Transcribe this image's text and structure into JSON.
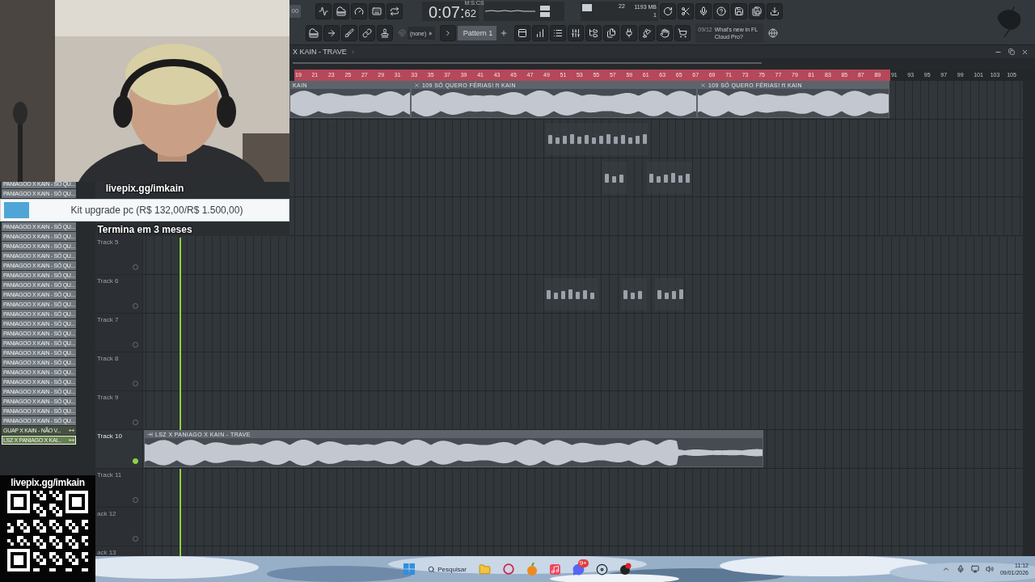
{
  "toolbar": {
    "tempo": "00",
    "time_unit": "M:S:CS",
    "time": "0:07:",
    "time_cs": "62",
    "cpu": "22",
    "memory": "1193 MB",
    "polyphony": "1",
    "snap": "(none)",
    "pattern": "Pattern 1",
    "news_count": "09/12",
    "news": "What's new in FL Cloud Pro?"
  },
  "pattern_list": [
    {
      "label": "PANIAGOO X KAIN - SÓ QU...",
      "kind": "pattern",
      "selected": false
    },
    {
      "label": "PANIAGOO X KAIN - SÓ QU...",
      "kind": "pattern",
      "selected": false
    },
    {
      "label": "PANIAGOO X KAIN - SÓ QU...",
      "kind": "pattern",
      "selected": false
    },
    {
      "label": "PANIAGOO X KAIN - SÓ QU...",
      "kind": "pattern",
      "selected": false
    },
    {
      "label": "PANIAGOO X KAIN - SÓ QU...",
      "kind": "pattern",
      "selected": false
    },
    {
      "label": "PANIAGOO X KAIN - SÓ QU...",
      "kind": "pattern",
      "selected": false
    },
    {
      "label": "PANIAGOO X KAIN - SÓ QU...",
      "kind": "pattern",
      "selected": false
    },
    {
      "label": "PANIAGOO X KAIN - SÓ QU...",
      "kind": "pattern",
      "selected": false
    },
    {
      "label": "PANIAGOO X KAIN - SÓ QU...",
      "kind": "pattern",
      "selected": false
    },
    {
      "label": "PANIAGOO X KAIN - SÓ QU...",
      "kind": "pattern",
      "selected": false
    },
    {
      "label": "PANIAGOO X KAIN - SÓ QU...",
      "kind": "pattern",
      "selected": false
    },
    {
      "label": "PANIAGOO X KAIN - SÓ QU...",
      "kind": "pattern",
      "selected": false
    },
    {
      "label": "PANIAGOO X KAIN - SÓ QU...",
      "kind": "pattern",
      "selected": false
    },
    {
      "label": "PANIAGOO X KAIN - SÓ QU...",
      "kind": "pattern",
      "selected": false
    },
    {
      "label": "PANIAGOO X KAIN - SÓ QU...",
      "kind": "pattern",
      "selected": false
    },
    {
      "label": "PANIAGOO X KAIN - SÓ QU...",
      "kind": "pattern",
      "selected": false
    },
    {
      "label": "PANIAGOO X KAIN - SÓ QU...",
      "kind": "pattern",
      "selected": false
    },
    {
      "label": "PANIAGOO X KAIN - SÓ QU...",
      "kind": "pattern",
      "selected": false
    },
    {
      "label": "PANIAGOO X KAIN - SÓ QU...",
      "kind": "pattern",
      "selected": false
    },
    {
      "label": "PANIAGOO X KAIN - SÓ QU...",
      "kind": "pattern",
      "selected": false
    },
    {
      "label": "PANIAGOO X KAIN - SÓ QU...",
      "kind": "pattern",
      "selected": false
    },
    {
      "label": "PANIAGOO X KAIN - SÓ QU...",
      "kind": "pattern",
      "selected": false
    },
    {
      "label": "PANIAGOO X KAIN - SÓ QU...",
      "kind": "pattern",
      "selected": false
    },
    {
      "label": "GUAP X KAIN - NÃO V...",
      "kind": "audio",
      "selected": false
    },
    {
      "label": "LSZ X PANIAGO X KAI...",
      "kind": "audio",
      "selected": true
    }
  ],
  "playlist": {
    "title": "X KAIN - TRAVE",
    "ruler": [
      {
        "label": "19",
        "selected": true
      },
      {
        "label": "21",
        "selected": true
      },
      {
        "label": "23",
        "selected": true
      },
      {
        "label": "25",
        "selected": true
      },
      {
        "label": "27",
        "selected": true
      },
      {
        "label": "29",
        "selected": true
      },
      {
        "label": "31",
        "selected": true
      },
      {
        "label": "33",
        "selected": true
      },
      {
        "label": "35",
        "selected": true
      },
      {
        "label": "37",
        "selected": true
      },
      {
        "label": "39",
        "selected": true
      },
      {
        "label": "41",
        "selected": true
      },
      {
        "label": "43",
        "selected": true
      },
      {
        "label": "45",
        "selected": true
      },
      {
        "label": "47",
        "selected": true
      },
      {
        "label": "49",
        "selected": true
      },
      {
        "label": "51",
        "selected": true
      },
      {
        "label": "53",
        "selected": true
      },
      {
        "label": "55",
        "selected": true
      },
      {
        "label": "57",
        "selected": true
      },
      {
        "label": "59",
        "selected": true
      },
      {
        "label": "61",
        "selected": true
      },
      {
        "label": "63",
        "selected": true
      },
      {
        "label": "65",
        "selected": true
      },
      {
        "label": "67",
        "selected": true
      },
      {
        "label": "69",
        "selected": true
      },
      {
        "label": "71",
        "selected": true
      },
      {
        "label": "73",
        "selected": true
      },
      {
        "label": "75",
        "selected": true
      },
      {
        "label": "77",
        "selected": true
      },
      {
        "label": "79",
        "selected": true
      },
      {
        "label": "81",
        "selected": true
      },
      {
        "label": "83",
        "selected": true
      },
      {
        "label": "85",
        "selected": true
      },
      {
        "label": "87",
        "selected": true
      },
      {
        "label": "89",
        "selected": true
      },
      {
        "label": "91",
        "selected": false
      },
      {
        "label": "93",
        "selected": false
      },
      {
        "label": "95",
        "selected": false
      },
      {
        "label": "97",
        "selected": false
      },
      {
        "label": "99",
        "selected": false
      },
      {
        "label": "101",
        "selected": false
      },
      {
        "label": "103",
        "selected": false
      },
      {
        "label": "105",
        "selected": false
      }
    ],
    "track_headers": [
      {
        "name": "Track 5",
        "active": false
      },
      {
        "name": "Track 6",
        "active": false
      },
      {
        "name": "Track 7",
        "active": false
      },
      {
        "name": "Track 8",
        "active": false
      },
      {
        "name": "Track 9",
        "active": false
      },
      {
        "name": "Track 10",
        "active": true
      },
      {
        "name": "Track 11",
        "active": false
      },
      {
        "name": "ack 12",
        "active": false
      },
      {
        "name": "ack 13"
      }
    ],
    "tracks": [
      {
        "clips": [
          {
            "kind": "audio",
            "label": "KAIN"
          },
          {
            "kind": "audio",
            "label": "109 SÓ QUERO FÉRIAS! ft KAIN"
          },
          {
            "kind": "audio",
            "label": "109 SÓ QUERO FÉRIAS! ft KAIN"
          }
        ]
      },
      {
        "clips": [
          {
            "kind": "slices"
          }
        ]
      },
      {
        "clips": [
          {
            "kind": "slices"
          },
          {
            "kind": "slices"
          }
        ]
      },
      {
        "clips": [
          {
            "kind": "slices"
          },
          {
            "kind": "slices"
          },
          {
            "kind": "slices"
          }
        ]
      },
      {
        "clips": [
          {
            "kind": "audio",
            "label": "LSZ X PANIAGO X KAIN - TRAVE"
          }
        ]
      }
    ]
  },
  "stream_overlay": {
    "link": "livepix.gg/imkain",
    "goal": {
      "label": "Kit upgrade pc (R$ 132,00/R$ 1.500,00)",
      "level": 0.088
    },
    "deadline": "Termina em 3 meses",
    "qr_link": "livepix.gg/imkain"
  },
  "taskbar": {
    "search": "Pesquisar",
    "chat_badge": "9+",
    "time": "11:12",
    "date": "09/01/2026"
  }
}
